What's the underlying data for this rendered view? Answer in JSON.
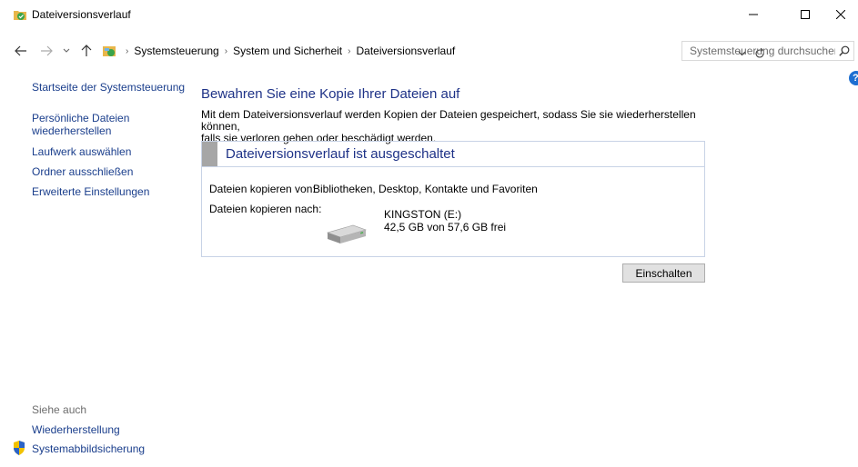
{
  "window": {
    "title": "Dateiversionsverlauf",
    "minimize_label": "—",
    "maximize_label": "☐",
    "close_label": "✕"
  },
  "addressbar": {
    "crumbs": [
      "Systemsteuerung",
      "System und Sicherheit",
      "Dateiversionsverlauf"
    ],
    "separator": "›",
    "search_placeholder": "Systemsteuerung durchsuchen"
  },
  "sidebar": {
    "home": "Startseite der Systemsteuerung",
    "restore_line1": "Persönliche Dateien",
    "restore_line2": "wiederherstellen",
    "select_drive": "Laufwerk auswählen",
    "exclude_folders": "Ordner ausschließen",
    "advanced": "Erweiterte Einstellungen",
    "see_also": "Siehe auch",
    "recovery": "Wiederherstellung",
    "system_image": "Systemabbildsicherung"
  },
  "main": {
    "heading": "Bewahren Sie eine Kopie Ihrer Dateien auf",
    "desc_line1": "Mit dem Dateiversionsverlauf werden Kopien der Dateien gespeichert, sodass Sie sie wiederherstellen können,",
    "desc_line2": "falls sie verloren gehen oder beschädigt werden.",
    "status_title": "Dateiversionsverlauf ist ausgeschaltet",
    "copy_from_label": "Dateien kopieren von:",
    "copy_from_value": "Bibliotheken, Desktop, Kontakte und Favoriten",
    "copy_to_label": "Dateien kopieren nach:",
    "drive_name": "KINGSTON (E:)",
    "drive_space": "42,5 GB von 57,6 GB frei",
    "turn_on_button": "Einschalten"
  },
  "colors": {
    "link": "#1a3e8c",
    "heading": "#1e3287",
    "panel_border": "#c8d3e6"
  }
}
